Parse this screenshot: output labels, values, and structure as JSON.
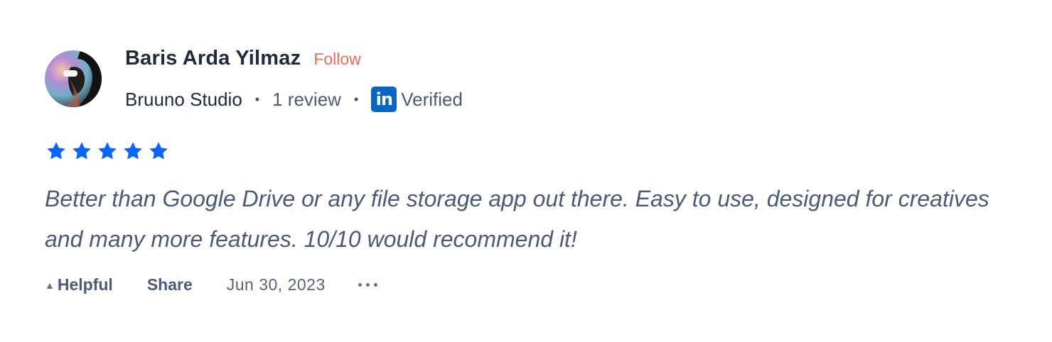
{
  "review": {
    "author": {
      "name": "Baris Arda Yilmaz",
      "follow_label": "Follow",
      "company": "Bruuno Studio",
      "separator": "•",
      "review_count": "1 review",
      "linkedin_badge": "in",
      "verified_label": "Verified"
    },
    "rating": {
      "value": 5,
      "max": 5,
      "star_color": "#0866ff"
    },
    "text": "Better than Google Drive or any file storage app out there. Easy to use, designed for creatives and many more features. 10/10 would recommend it!",
    "actions": {
      "helpful_caret": "▲",
      "helpful_label": "Helpful",
      "share_label": "Share",
      "date": "Jun 30, 2023"
    }
  }
}
